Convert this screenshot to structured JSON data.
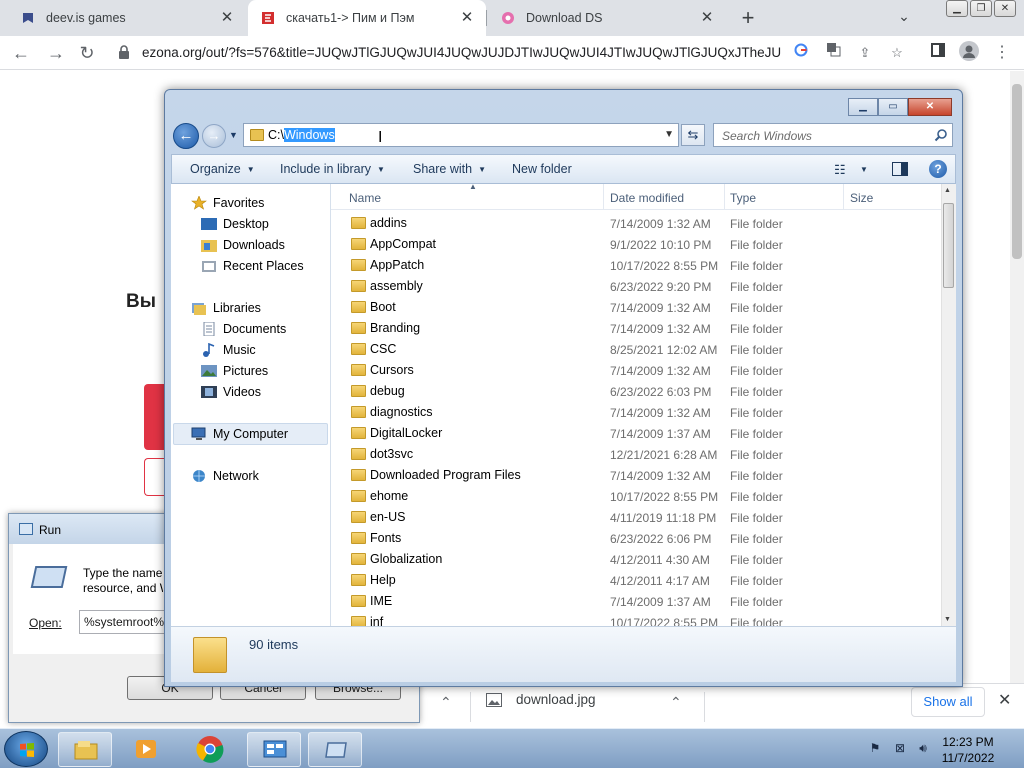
{
  "browser": {
    "tabs": [
      {
        "label": "deev.is games"
      },
      {
        "label": "скачать1-> Пим и Пэм"
      },
      {
        "label": "Download DS"
      }
    ],
    "url": "ezona.org/out/?fs=576&title=JUQwJTlGJUQwJUI4JUQwJUJDJTIwJUQwJUI4JTIwJUQwJTlGJUQxJTheJU...",
    "page_heading": "Вы"
  },
  "downloads": {
    "file": "download.jpg",
    "show_all": "Show all"
  },
  "run_dialog": {
    "title": "Run",
    "description_line1": "Type the name of a program, folder, document, or Internet",
    "description_line2": "resource, and Windows will open it for you.",
    "open_label": "Open:",
    "open_value": "%systemroot%",
    "ok": "OK",
    "cancel": "Cancel",
    "browse": "Browse..."
  },
  "explorer": {
    "address_prefix": "C:\\",
    "address_selected": "Windows",
    "search_placeholder": "Search Windows",
    "commands": {
      "organize": "Organize",
      "include": "Include in library",
      "share": "Share with",
      "new_folder": "New folder"
    },
    "nav": {
      "favorites": "Favorites",
      "desktop": "Desktop",
      "downloads": "Downloads",
      "recent": "Recent Places",
      "libraries": "Libraries",
      "documents": "Documents",
      "music": "Music",
      "pictures": "Pictures",
      "videos": "Videos",
      "computer": "My Computer",
      "network": "Network"
    },
    "columns": {
      "name": "Name",
      "date": "Date modified",
      "type": "Type",
      "size": "Size"
    },
    "files": [
      {
        "name": "addins",
        "date": "7/14/2009 1:32 AM",
        "type": "File folder"
      },
      {
        "name": "AppCompat",
        "date": "9/1/2022 10:10 PM",
        "type": "File folder"
      },
      {
        "name": "AppPatch",
        "date": "10/17/2022 8:55 PM",
        "type": "File folder"
      },
      {
        "name": "assembly",
        "date": "6/23/2022 9:20 PM",
        "type": "File folder"
      },
      {
        "name": "Boot",
        "date": "7/14/2009 1:32 AM",
        "type": "File folder"
      },
      {
        "name": "Branding",
        "date": "7/14/2009 1:32 AM",
        "type": "File folder"
      },
      {
        "name": "CSC",
        "date": "8/25/2021 12:02 AM",
        "type": "File folder"
      },
      {
        "name": "Cursors",
        "date": "7/14/2009 1:32 AM",
        "type": "File folder"
      },
      {
        "name": "debug",
        "date": "6/23/2022 6:03 PM",
        "type": "File folder"
      },
      {
        "name": "diagnostics",
        "date": "7/14/2009 1:32 AM",
        "type": "File folder"
      },
      {
        "name": "DigitalLocker",
        "date": "7/14/2009 1:37 AM",
        "type": "File folder"
      },
      {
        "name": "dot3svc",
        "date": "12/21/2021 6:28 AM",
        "type": "File folder"
      },
      {
        "name": "Downloaded Program Files",
        "date": "7/14/2009 1:32 AM",
        "type": "File folder"
      },
      {
        "name": "ehome",
        "date": "10/17/2022 8:55 PM",
        "type": "File folder"
      },
      {
        "name": "en-US",
        "date": "4/11/2019 11:18 PM",
        "type": "File folder"
      },
      {
        "name": "Fonts",
        "date": "6/23/2022 6:06 PM",
        "type": "File folder"
      },
      {
        "name": "Globalization",
        "date": "4/12/2011 4:30 AM",
        "type": "File folder"
      },
      {
        "name": "Help",
        "date": "4/12/2011 4:17 AM",
        "type": "File folder"
      },
      {
        "name": "IME",
        "date": "7/14/2009 1:37 AM",
        "type": "File folder"
      },
      {
        "name": "inf",
        "date": "10/17/2022 8:55 PM",
        "type": "File folder"
      }
    ],
    "item_count": "90 items"
  },
  "taskbar": {
    "time": "12:23 PM",
    "date": "11/7/2022"
  }
}
